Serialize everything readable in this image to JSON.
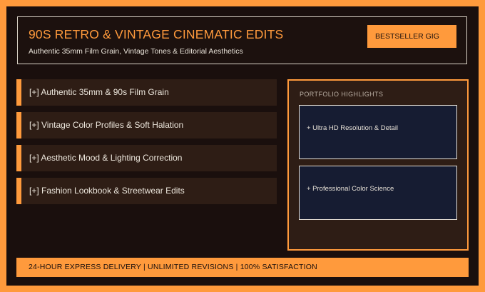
{
  "header": {
    "title": "90S RETRO & VINTAGE CINEMATIC EDITS",
    "subtitle": "Authentic 35mm Film Grain, Vintage Tones & Editorial Aesthetics",
    "badge": "BESTSELLER GIG"
  },
  "features": [
    {
      "label": "[+] Authentic 35mm & 90s Film Grain"
    },
    {
      "label": "[+] Vintage Color Profiles & Soft Halation"
    },
    {
      "label": "[+] Aesthetic Mood & Lighting Correction"
    },
    {
      "label": "[+] Fashion Lookbook & Streetwear Edits"
    }
  ],
  "portfolio": {
    "heading": "PORTFOLIO HIGHLIGHTS",
    "cards": [
      {
        "label": "+ Ultra HD Resolution & Detail"
      },
      {
        "label": "+ Professional Color Science"
      }
    ]
  },
  "footer": {
    "text": "24-HOUR EXPRESS DELIVERY | UNLIMITED REVISIONS | 100% SATISFACTION"
  },
  "colors": {
    "accent": "#ff9a3c",
    "background": "#1a0f0d",
    "panel": "#2e1d15",
    "card": "#161c32"
  }
}
